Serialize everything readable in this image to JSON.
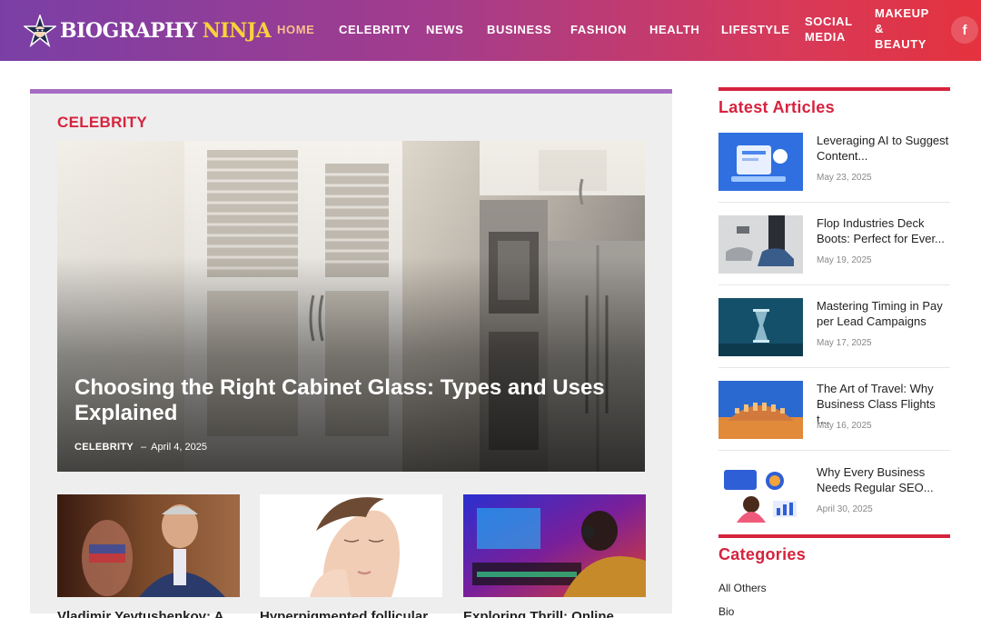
{
  "header": {
    "logo_word1": "BIOGRAPHY",
    "logo_word2": "NINJA",
    "nav": [
      {
        "label": "HOME"
      },
      {
        "label": "CELEBRITY"
      },
      {
        "label": "NEWS"
      },
      {
        "label": "BUSINESS"
      },
      {
        "label": "FASHION"
      },
      {
        "label": "HEALTH"
      },
      {
        "label": "LIFESTYLE"
      },
      {
        "label": "SOCIAL MEDIA"
      },
      {
        "label": "MAKEUP & BEAUTY"
      }
    ],
    "facebook_glyph": "f",
    "colors": {
      "gradient_start": "#7a3fa6",
      "gradient_end": "#e4323e",
      "active_nav": "#f7c08a",
      "logo_accent": "#f7d23b"
    }
  },
  "main": {
    "section_title": "CELEBRITY",
    "featured": {
      "title": "Choosing the Right Cabinet Glass: Types and Uses Explained",
      "category": "CELEBRITY",
      "date": "April 4, 2025"
    },
    "thumbs": [
      {
        "caption": "Vladimir Yevtushenkov: A..."
      },
      {
        "caption": "Hyperpigmented follicular..."
      },
      {
        "caption": "Exploring Thrill: Online Gam..."
      }
    ]
  },
  "sidebar": {
    "latest_title": "Latest Articles",
    "articles": [
      {
        "title": "Leveraging AI to Suggest Content...",
        "date": "May 23, 2025"
      },
      {
        "title": "Flop Industries Deck Boots: Perfect for Ever...",
        "date": "May 19, 2025"
      },
      {
        "title": "Mastering Timing in Pay per Lead Campaigns",
        "date": "May 17, 2025"
      },
      {
        "title": "The Art of Travel: Why Business Class Flights t...",
        "date": "May 16, 2025"
      },
      {
        "title": "Why Every Business Needs Regular SEO...",
        "date": "April 30, 2025"
      }
    ],
    "categories_title": "Categories",
    "categories": [
      {
        "label": "All Others"
      },
      {
        "label": "Bio"
      }
    ],
    "accent": "#d6233e"
  }
}
